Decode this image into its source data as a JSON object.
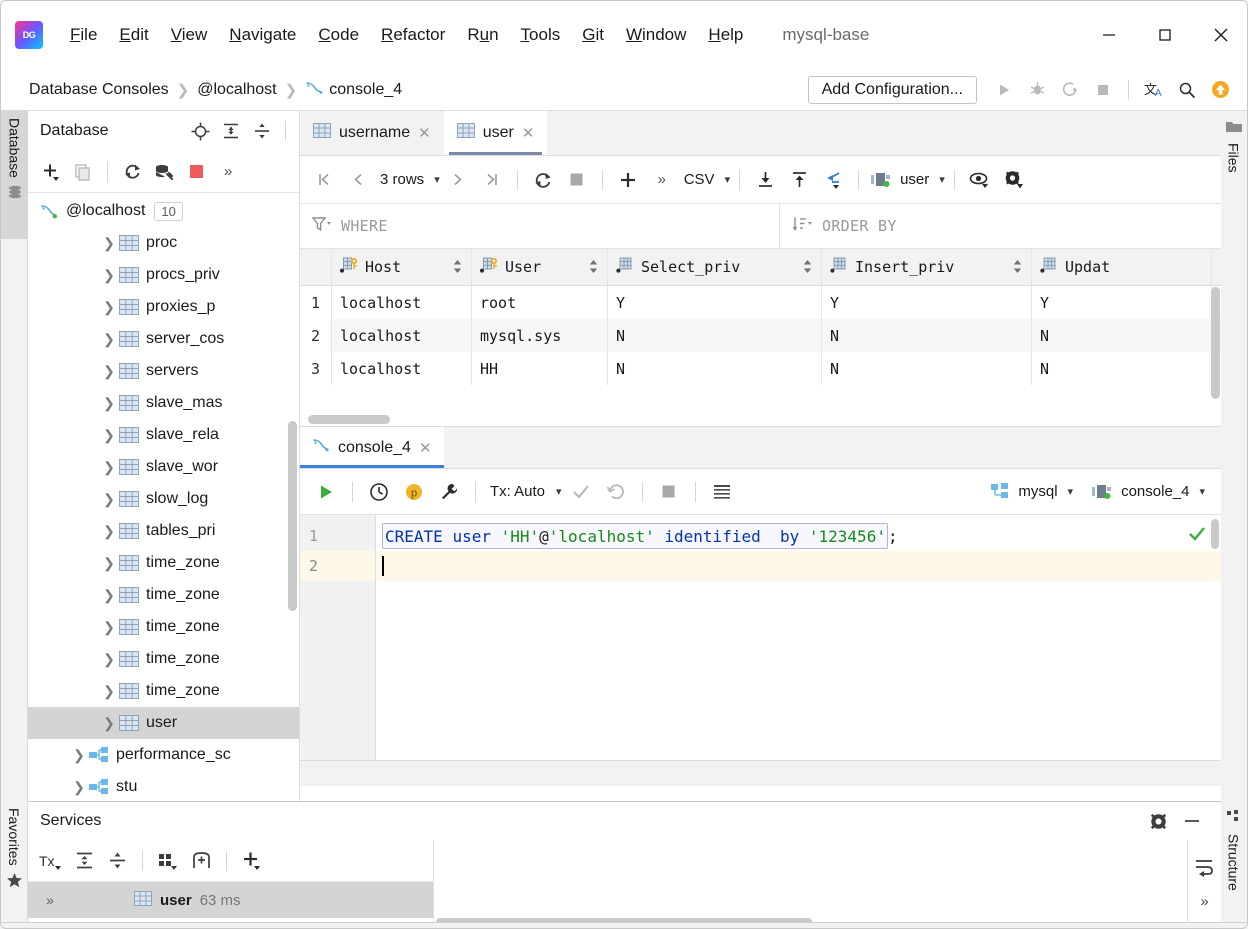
{
  "window": {
    "project_title": "mysql-base",
    "menu": [
      {
        "label": "File",
        "mnemonic": "F"
      },
      {
        "label": "Edit",
        "mnemonic": "E"
      },
      {
        "label": "View",
        "mnemonic": "V"
      },
      {
        "label": "Navigate",
        "mnemonic": "N"
      },
      {
        "label": "Code",
        "mnemonic": "C"
      },
      {
        "label": "Refactor",
        "mnemonic": "R"
      },
      {
        "label": "Run",
        "mnemonic": "u"
      },
      {
        "label": "Tools",
        "mnemonic": "T"
      },
      {
        "label": "Git",
        "mnemonic": "G"
      },
      {
        "label": "Window",
        "mnemonic": "W"
      },
      {
        "label": "Help",
        "mnemonic": "H"
      }
    ],
    "controls": {
      "minimize": "minimize-button",
      "maximize": "maximize-button",
      "close": "close-button"
    }
  },
  "navbar": {
    "breadcrumbs": [
      "Database Consoles",
      "@localhost",
      "console_4"
    ],
    "add_configuration": "Add Configuration...",
    "icons": [
      "run-icon",
      "debug-icon",
      "run-with-coverage-icon",
      "stop-icon",
      "translate-icon",
      "search-everywhere-icon",
      "update-icon"
    ]
  },
  "left_stripe": {
    "database_label": "Database",
    "favorites_label": "Favorites"
  },
  "right_stripe": {
    "files_label": "Files",
    "structure_label": "Structure"
  },
  "database_panel": {
    "title": "Database",
    "header_icons": [
      "target-icon",
      "expand-all-icon",
      "collapse-all-icon"
    ],
    "toolbar_icons": [
      "add-icon",
      "copy-icon",
      "refresh-icon",
      "datasource-properties-icon",
      "stop-icon",
      "more-icon"
    ],
    "connection": {
      "name": "@localhost",
      "count": "10"
    },
    "tables": [
      {
        "label": "proc",
        "type": "table"
      },
      {
        "label": "procs_priv",
        "type": "table"
      },
      {
        "label": "proxies_p",
        "type": "table"
      },
      {
        "label": "server_cos",
        "type": "table"
      },
      {
        "label": "servers",
        "type": "table"
      },
      {
        "label": "slave_mas",
        "type": "table"
      },
      {
        "label": "slave_rela",
        "type": "table"
      },
      {
        "label": "slave_wor",
        "type": "table"
      },
      {
        "label": "slow_log",
        "type": "table"
      },
      {
        "label": "tables_pri",
        "type": "table"
      },
      {
        "label": "time_zone",
        "type": "table"
      },
      {
        "label": "time_zone",
        "type": "table"
      },
      {
        "label": "time_zone",
        "type": "table"
      },
      {
        "label": "time_zone",
        "type": "table"
      },
      {
        "label": "time_zone",
        "type": "table"
      },
      {
        "label": "user",
        "type": "table",
        "selected": true
      }
    ],
    "schemas": [
      {
        "label": "performance_sc",
        "type": "schema"
      },
      {
        "label": "stu",
        "type": "schema"
      }
    ]
  },
  "result_tabs": [
    {
      "label": "username",
      "active": false
    },
    {
      "label": "user",
      "active": true
    }
  ],
  "result_toolbar": {
    "row_count": "3 rows",
    "format": "CSV",
    "schema_chip": "user",
    "icons": [
      "first-page-icon",
      "prev-page-icon",
      "next-page-icon",
      "last-page-icon",
      "reload-icon",
      "stop-icon",
      "add-row-icon",
      "more-icon",
      "download-icon",
      "upload-icon",
      "jump-to-icon",
      "db-chip-icon",
      "view-options-icon",
      "settings-icon"
    ]
  },
  "filters": {
    "where_label": "WHERE",
    "order_by_label": "ORDER BY"
  },
  "grid": {
    "columns": [
      "Host",
      "User",
      "Select_priv",
      "Insert_priv",
      "Updat"
    ],
    "column_key_flags": [
      true,
      true,
      false,
      false,
      false
    ],
    "rows": [
      {
        "n": "1",
        "cells": [
          "localhost",
          "root",
          "Y",
          "Y",
          "Y"
        ]
      },
      {
        "n": "2",
        "cells": [
          "localhost",
          "mysql.sys",
          "N",
          "N",
          "N"
        ]
      },
      {
        "n": "3",
        "cells": [
          "localhost",
          "HH",
          "N",
          "N",
          "N"
        ]
      }
    ]
  },
  "console": {
    "tab_label": "console_4",
    "toolbar": {
      "tx_label": "Tx: Auto",
      "schema_chip": "mysql",
      "session_chip": "console_4",
      "icons": [
        "execute-icon",
        "history-icon",
        "parameters-icon",
        "wrench-icon",
        "commit-icon",
        "rollback-icon",
        "stop-icon",
        "output-icon"
      ]
    },
    "editor": {
      "lines": [
        "1",
        "2"
      ],
      "statement_tokens": [
        {
          "t": "CREATE",
          "c": "kw"
        },
        {
          "t": " ",
          "c": "pl"
        },
        {
          "t": "user",
          "c": "kw"
        },
        {
          "t": " ",
          "c": "pl"
        },
        {
          "t": "'HH'",
          "c": "str"
        },
        {
          "t": "@",
          "c": "pl"
        },
        {
          "t": "'localhost'",
          "c": "str"
        },
        {
          "t": " ",
          "c": "pl"
        },
        {
          "t": "identified",
          "c": "kw"
        },
        {
          "t": "  ",
          "c": "pl"
        },
        {
          "t": "by",
          "c": "kw"
        },
        {
          "t": " ",
          "c": "pl"
        },
        {
          "t": "'123456'",
          "c": "str"
        }
      ],
      "statement_terminator": ";",
      "full_text": "CREATE user 'HH'@'localhost' identified  by '123456';",
      "inspection_status": "ok-check-icon"
    }
  },
  "services": {
    "title": "Services",
    "header_icons": [
      "settings-icon",
      "hide-icon"
    ],
    "toolbar_icons": [
      "tx-icon",
      "expand-all-icon",
      "collapse-all-icon",
      "group-icon",
      "add-tab-icon",
      "add-icon"
    ],
    "row": {
      "more": "»",
      "name": "user",
      "duration": "63 ms"
    },
    "right_icons": [
      "wrap-icon",
      "more-icon"
    ]
  }
}
